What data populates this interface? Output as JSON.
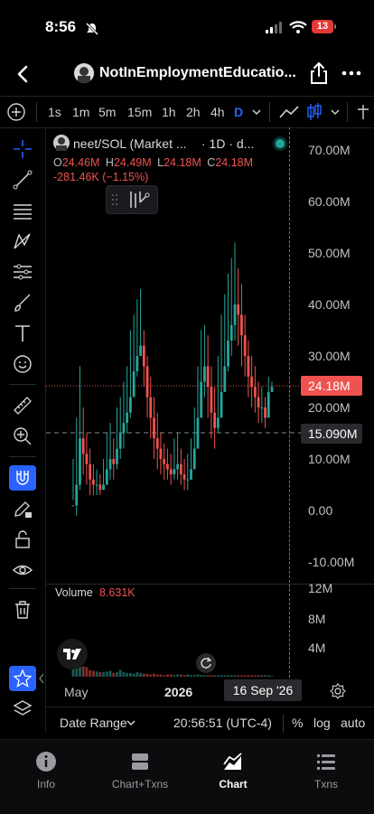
{
  "status_bar": {
    "time": "8:56",
    "battery": "13"
  },
  "header": {
    "title": "NotInEmploymentEducatio..."
  },
  "toolbar": {
    "timeframes": [
      "1s",
      "1m",
      "5m",
      "15m",
      "1h",
      "2h",
      "4h",
      "D"
    ],
    "active_timeframe": "D"
  },
  "legend": {
    "symbol": "neet/SOL (Market ...",
    "interval": "· 1D · d...",
    "open_label": "O",
    "open": "24.46M",
    "high_label": "H",
    "high": "24.49M",
    "low_label": "L",
    "low": "24.18M",
    "close_label": "C",
    "close": "24.18M",
    "change": "-281.46K (−1.15%)"
  },
  "price_axis": {
    "labels": [
      "70.00M",
      "60.00M",
      "50.00M",
      "40.00M",
      "30.00M",
      "20.00M",
      "10.00M",
      "0.00",
      "-10.00M"
    ],
    "last_price": "24.18M",
    "crosshair_price": "15.090M"
  },
  "volume": {
    "label": "Volume",
    "value": "8.631K",
    "axis_labels": [
      "12M",
      "8M",
      "4M"
    ]
  },
  "time_axis": {
    "labels": [
      "May",
      "2026"
    ],
    "crosshair_date": "16 Sep '26"
  },
  "bottom_bar": {
    "date_range": "Date Range",
    "clock": "20:56:51 (UTC-4)",
    "percent": "%",
    "log": "log",
    "auto": "auto"
  },
  "tabs": [
    {
      "label": "Info",
      "icon": "info-icon"
    },
    {
      "label": "Chart+Txns",
      "icon": "split-view-icon"
    },
    {
      "label": "Chart",
      "icon": "chart-icon",
      "active": true
    },
    {
      "label": "Txns",
      "icon": "list-icon"
    }
  ],
  "colors": {
    "up": "#26a69a",
    "down": "#ef5350",
    "accent": "#2962ff",
    "background": "#000000"
  },
  "chart_data": {
    "type": "candlestick",
    "series_name": "neet/SOL",
    "ylim": [
      -10000000,
      70000000
    ],
    "volume_ylim": [
      0,
      12000000
    ],
    "last_price": 24180000,
    "candles": [
      [
        1,
        10,
        2
      ],
      [
        5,
        18,
        -1
      ],
      [
        14,
        28,
        4
      ],
      [
        11,
        20,
        7
      ],
      [
        9,
        15,
        5
      ],
      [
        6,
        12,
        3
      ],
      [
        5,
        9,
        3
      ],
      [
        5,
        8,
        3
      ],
      [
        4,
        7,
        3
      ],
      [
        5,
        10,
        4
      ],
      [
        8,
        15,
        5
      ],
      [
        10,
        17,
        6
      ],
      [
        9,
        14,
        6
      ],
      [
        12,
        20,
        8
      ],
      [
        15,
        22,
        10
      ],
      [
        17,
        25,
        12
      ],
      [
        19,
        28,
        15
      ],
      [
        22,
        35,
        18
      ],
      [
        27,
        38,
        22
      ],
      [
        30,
        41,
        26
      ],
      [
        32,
        43,
        30
      ],
      [
        28,
        35,
        24
      ],
      [
        22,
        30,
        18
      ],
      [
        18,
        26,
        14
      ],
      [
        14,
        22,
        10
      ],
      [
        12,
        19,
        8
      ],
      [
        10,
        15,
        7
      ],
      [
        9,
        13,
        6
      ],
      [
        8,
        12,
        6
      ],
      [
        7,
        11,
        5
      ],
      [
        8,
        14,
        6
      ],
      [
        9,
        15,
        6
      ],
      [
        7,
        12,
        5
      ],
      [
        6,
        10,
        4
      ],
      [
        6,
        11,
        4
      ],
      [
        8,
        14,
        6
      ],
      [
        12,
        20,
        8
      ],
      [
        18,
        28,
        12
      ],
      [
        25,
        35,
        20
      ],
      [
        28,
        36,
        22
      ],
      [
        24,
        34,
        18
      ],
      [
        19,
        28,
        14
      ],
      [
        16,
        24,
        12
      ],
      [
        18,
        30,
        15
      ],
      [
        23,
        38,
        20
      ],
      [
        28,
        42,
        24
      ],
      [
        33,
        46,
        27
      ],
      [
        36,
        49,
        30
      ],
      [
        40,
        52,
        33
      ],
      [
        38,
        47,
        32
      ],
      [
        34,
        44,
        28
      ],
      [
        30,
        38,
        26
      ],
      [
        26,
        33,
        22
      ],
      [
        24,
        30,
        20
      ],
      [
        22,
        28,
        19
      ],
      [
        20,
        25,
        17
      ],
      [
        20,
        24,
        17
      ],
      [
        18,
        22,
        16
      ],
      [
        23,
        26,
        20
      ],
      [
        24,
        25,
        23
      ]
    ],
    "volumes": [
      1.6,
      3.3,
      1.5,
      1.4,
      1.3,
      0.9,
      0.8,
      0.7,
      0.6,
      0.6,
      0.7,
      0.8,
      0.5,
      0.6,
      0.9,
      0.6,
      0.5,
      0.5,
      0.4,
      0.6,
      0.5,
      0.4,
      0.4,
      0.3,
      0.4,
      0.3,
      0.3,
      0.2,
      0.3,
      0.3,
      0.2,
      0.3,
      0.3,
      0.2,
      0.3,
      0.2,
      0.2,
      0.3,
      0.2,
      0.2,
      0.2,
      0.2,
      0.2,
      0.2,
      0.2,
      0.2,
      0.2,
      0.2,
      0.2,
      0.2,
      0.2,
      0.2,
      0.2,
      0.2,
      0.2,
      0.2,
      0.2,
      0.2,
      0.2,
      0.1
    ]
  }
}
